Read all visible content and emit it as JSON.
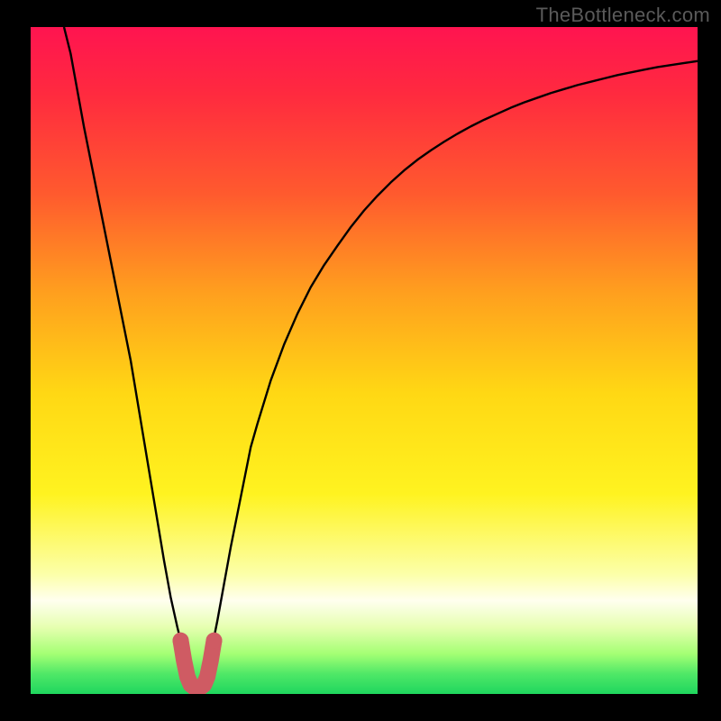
{
  "watermark": "TheBottleneck.com",
  "chart_data": {
    "type": "line",
    "title": "",
    "xlabel": "",
    "ylabel": "",
    "xlim": [
      0,
      1
    ],
    "ylim": [
      0,
      1
    ],
    "background_gradient": {
      "stops": [
        {
          "offset": 0.0,
          "color": "#ff1450"
        },
        {
          "offset": 0.1,
          "color": "#ff2a3f"
        },
        {
          "offset": 0.25,
          "color": "#ff5a2e"
        },
        {
          "offset": 0.4,
          "color": "#ffa01e"
        },
        {
          "offset": 0.55,
          "color": "#ffd814"
        },
        {
          "offset": 0.7,
          "color": "#fff320"
        },
        {
          "offset": 0.82,
          "color": "#fcffa8"
        },
        {
          "offset": 0.86,
          "color": "#ffffef"
        },
        {
          "offset": 0.9,
          "color": "#e6ffb0"
        },
        {
          "offset": 0.94,
          "color": "#a4ff74"
        },
        {
          "offset": 0.97,
          "color": "#4fe867"
        },
        {
          "offset": 1.0,
          "color": "#1fd65e"
        }
      ]
    },
    "series": [
      {
        "name": "bottleneck-curve",
        "stroke": "#000000",
        "stroke_width": 2.4,
        "x": [
          0.05,
          0.06,
          0.07,
          0.08,
          0.09,
          0.1,
          0.11,
          0.12,
          0.13,
          0.14,
          0.15,
          0.16,
          0.17,
          0.18,
          0.19,
          0.2,
          0.21,
          0.22,
          0.23,
          0.235,
          0.24,
          0.245,
          0.25,
          0.255,
          0.26,
          0.27,
          0.28,
          0.29,
          0.3,
          0.31,
          0.32,
          0.33,
          0.34,
          0.36,
          0.38,
          0.4,
          0.42,
          0.44,
          0.46,
          0.48,
          0.5,
          0.52,
          0.54,
          0.56,
          0.58,
          0.6,
          0.62,
          0.64,
          0.66,
          0.68,
          0.7,
          0.72,
          0.74,
          0.76,
          0.78,
          0.8,
          0.82,
          0.84,
          0.86,
          0.88,
          0.9,
          0.92,
          0.94,
          0.96,
          0.98,
          1.0
        ],
        "y": [
          1.0,
          0.96,
          0.905,
          0.85,
          0.8,
          0.75,
          0.7,
          0.65,
          0.6,
          0.55,
          0.5,
          0.44,
          0.38,
          0.32,
          0.26,
          0.2,
          0.145,
          0.1,
          0.06,
          0.04,
          0.024,
          0.013,
          0.01,
          0.013,
          0.024,
          0.06,
          0.11,
          0.165,
          0.22,
          0.27,
          0.32,
          0.37,
          0.405,
          0.47,
          0.524,
          0.57,
          0.61,
          0.643,
          0.672,
          0.7,
          0.725,
          0.747,
          0.767,
          0.785,
          0.801,
          0.815,
          0.828,
          0.84,
          0.851,
          0.861,
          0.87,
          0.879,
          0.887,
          0.894,
          0.901,
          0.907,
          0.913,
          0.918,
          0.923,
          0.928,
          0.932,
          0.936,
          0.94,
          0.943,
          0.946,
          0.949
        ]
      },
      {
        "name": "bottom-marker",
        "stroke": "#cf5b63",
        "stroke_width": 18,
        "linecap": "round",
        "x": [
          0.225,
          0.23,
          0.235,
          0.24,
          0.245,
          0.25,
          0.255,
          0.26,
          0.265,
          0.27,
          0.275
        ],
        "y": [
          0.08,
          0.05,
          0.026,
          0.014,
          0.01,
          0.01,
          0.01,
          0.014,
          0.026,
          0.05,
          0.08
        ]
      }
    ]
  }
}
